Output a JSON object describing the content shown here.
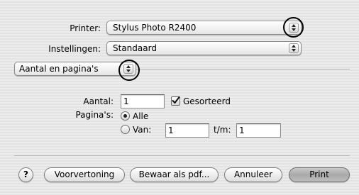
{
  "printer": {
    "label": "Printer:",
    "value": "Stylus Photo R2400"
  },
  "presets": {
    "label": "Instellingen:",
    "value": "Standaard"
  },
  "panel": {
    "value": "Aantal en pagina's"
  },
  "copies": {
    "label": "Aantal:",
    "value": "1",
    "collated_label": "Gesorteerd",
    "collated": true
  },
  "pages": {
    "label": "Pagina's:",
    "all_label": "Alle",
    "all_selected": true,
    "from_label": "Van:",
    "from_value": "1",
    "to_label": "t/m:",
    "to_value": "1"
  },
  "buttons": {
    "help": "?",
    "preview": "Voorvertoning",
    "save_pdf": "Bewaar als pdf...",
    "cancel": "Annuleer",
    "print": "Print"
  }
}
